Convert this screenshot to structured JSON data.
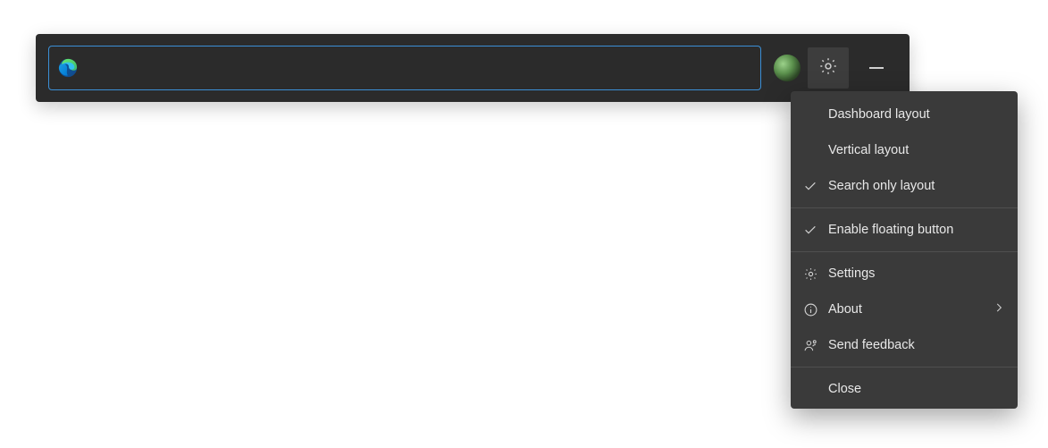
{
  "toolbar": {
    "search_value": "",
    "search_placeholder": ""
  },
  "menu": {
    "items": [
      {
        "label": "Dashboard layout",
        "icon": "",
        "checked": false
      },
      {
        "label": "Vertical layout",
        "icon": "",
        "checked": false
      },
      {
        "label": "Search only layout",
        "icon": "check",
        "checked": true
      }
    ],
    "floating": {
      "label": "Enable floating button",
      "icon": "check",
      "checked": true
    },
    "settings": {
      "label": "Settings",
      "icon": "gear"
    },
    "about": {
      "label": "About",
      "icon": "info",
      "has_submenu": true
    },
    "feedback": {
      "label": "Send feedback",
      "icon": "feedback"
    },
    "close": {
      "label": "Close"
    }
  }
}
